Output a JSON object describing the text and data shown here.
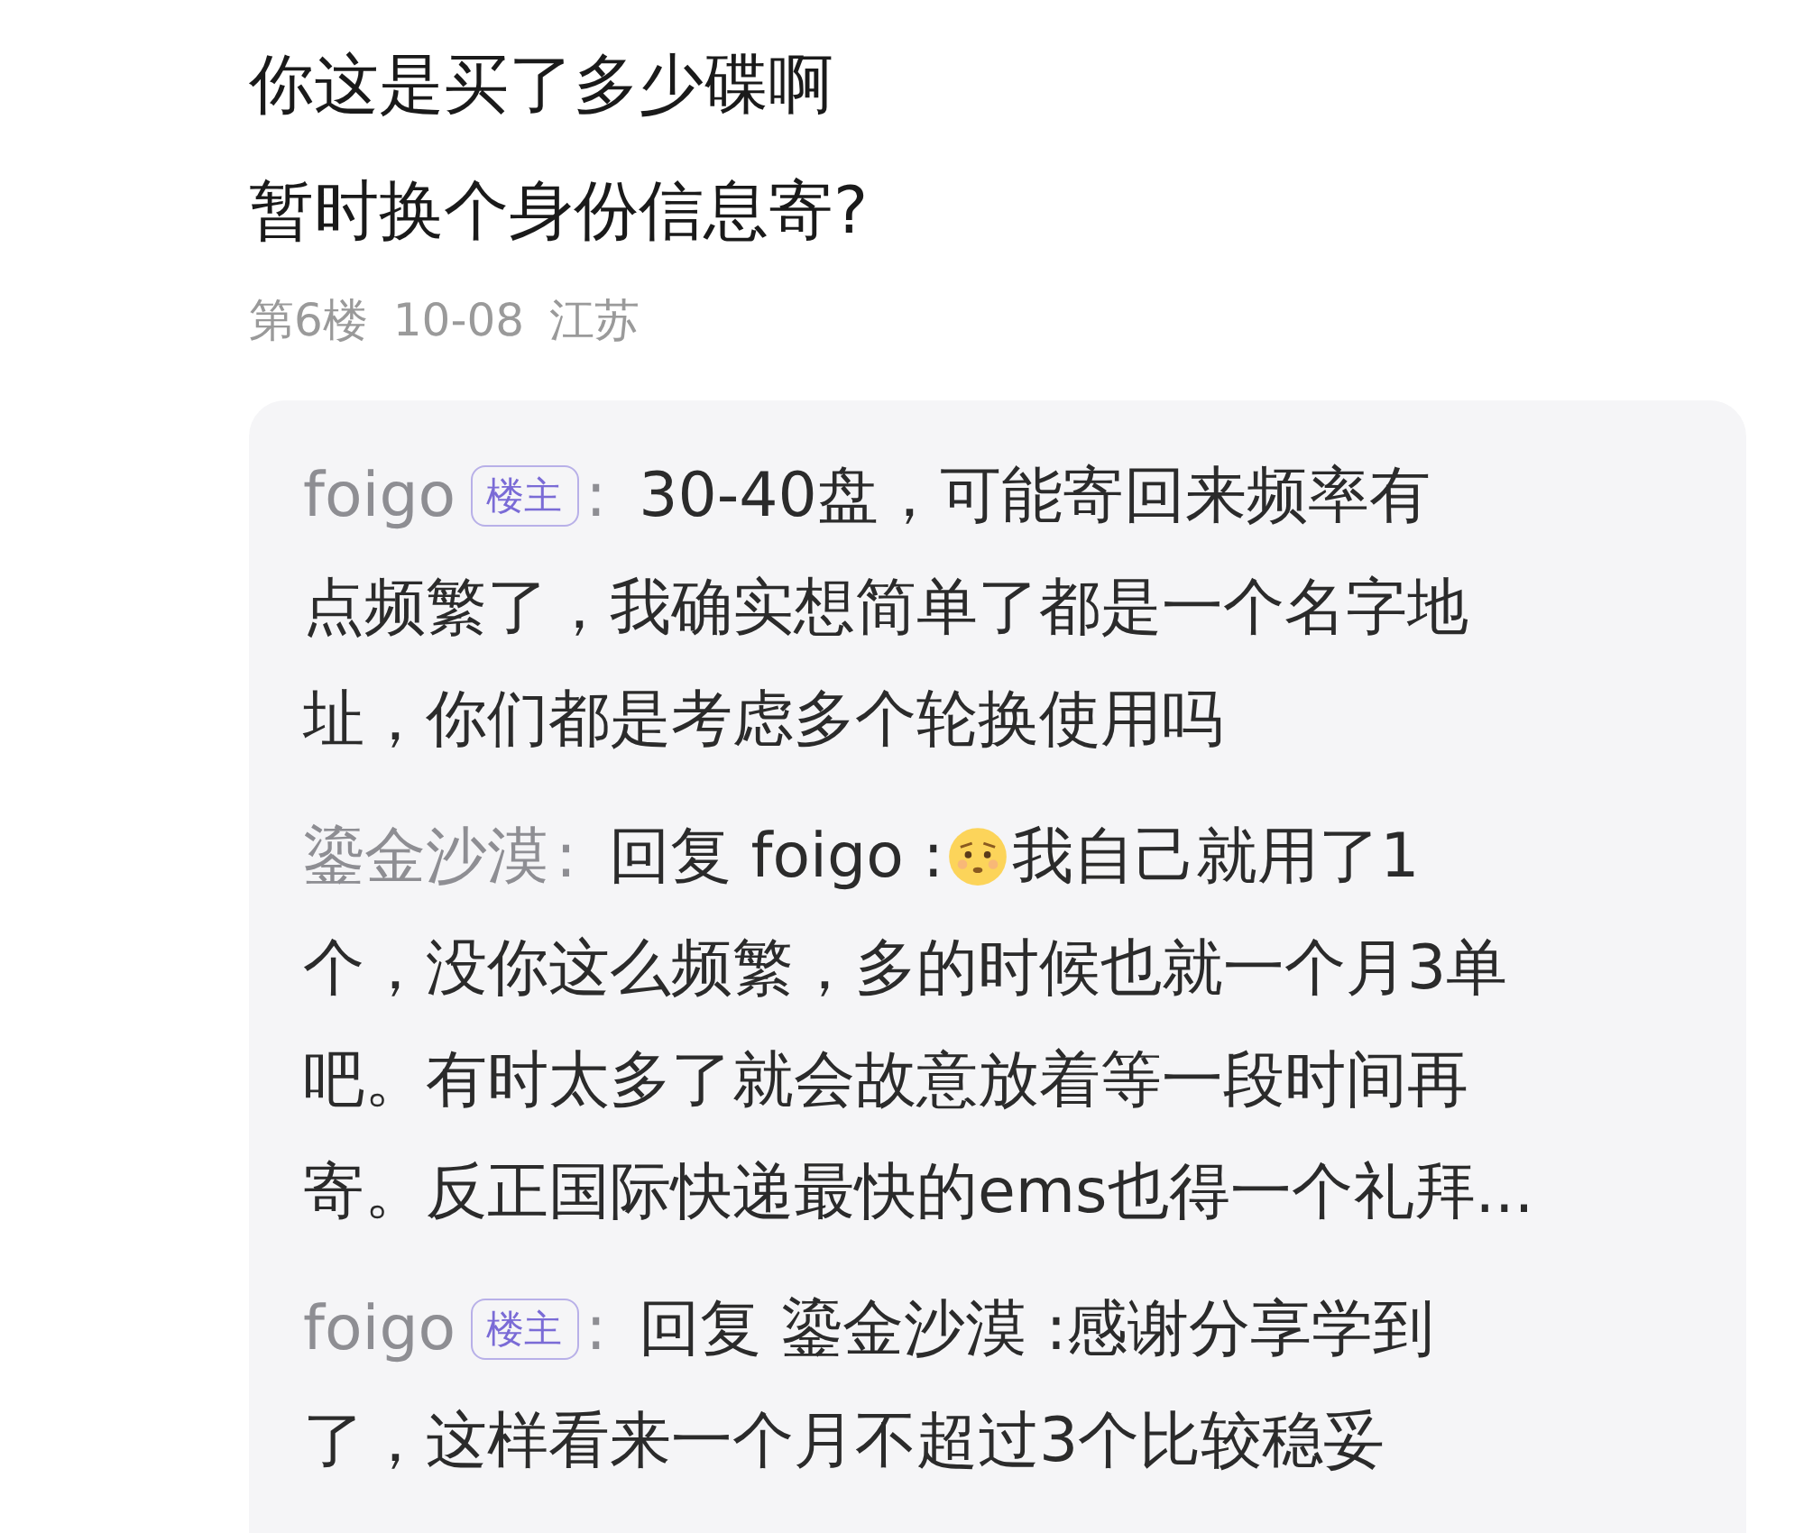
{
  "post": {
    "lines": [
      "你这是买了多少碟啊",
      "暂时换个身份信息寄?"
    ],
    "meta": [
      "第6楼",
      "10-08",
      "江苏"
    ]
  },
  "replies": [
    {
      "author": "foigo",
      "op": true,
      "op_label": "楼主",
      "separator": ":",
      "lines": [
        [
          {
            "kind": "text",
            "text": "30-40盘，可能寄回来频率有"
          }
        ],
        [
          {
            "kind": "text",
            "text": "点频繁了，我确实想简单了都是一个名字地"
          }
        ],
        [
          {
            "kind": "text",
            "text": "址，你们都是考虑多个轮换使用吗"
          }
        ]
      ]
    },
    {
      "author": "鎏金沙漠",
      "op": false,
      "separator": ":",
      "lines": [
        [
          {
            "kind": "text",
            "text": "回复 foigo :"
          },
          {
            "kind": "emoji"
          },
          {
            "kind": "text",
            "text": "我自己就用了1"
          }
        ],
        [
          {
            "kind": "text",
            "text": "个，没你这么频繁，多的时候也就一个月3单"
          }
        ],
        [
          {
            "kind": "text",
            "text": "吧。有时太多了就会故意放着等一段时间再"
          }
        ],
        [
          {
            "kind": "text",
            "text": "寄。反正国际快递最快的ems也得一个礼拜..."
          }
        ]
      ]
    },
    {
      "author": "foigo",
      "op": true,
      "op_label": "楼主",
      "separator": ":",
      "lines": [
        [
          {
            "kind": "text",
            "text": "回复 鎏金沙漠 :感谢分享学到"
          }
        ],
        [
          {
            "kind": "text",
            "text": "了，这样看来一个月不超过3个比较稳妥"
          }
        ]
      ]
    }
  ]
}
